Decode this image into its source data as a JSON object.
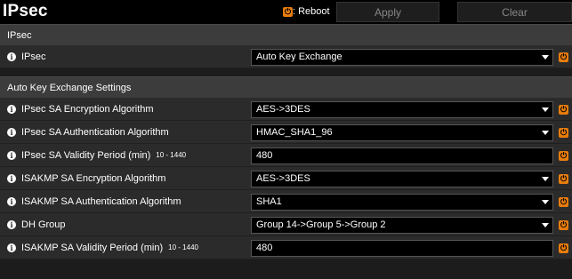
{
  "header": {
    "title": "IPsec",
    "reboot_label": ": Reboot",
    "apply_label": "Apply",
    "clear_label": "Clear"
  },
  "sections": [
    {
      "title": "IPsec"
    },
    {
      "title": "Auto Key Exchange Settings"
    }
  ],
  "ipsec_row": {
    "label": "IPsec",
    "value": "Auto Key Exchange"
  },
  "settings": [
    {
      "label": "IPsec SA Encryption Algorithm",
      "value": "AES->3DES",
      "type": "select"
    },
    {
      "label": "IPsec SA Authentication Algorithm",
      "value": "HMAC_SHA1_96",
      "type": "select"
    },
    {
      "label": "IPsec SA Validity Period (min)",
      "range": "10 - 1440",
      "value": "480",
      "type": "input"
    },
    {
      "label": "ISAKMP SA Encryption Algorithm",
      "value": "AES->3DES",
      "type": "select"
    },
    {
      "label": "ISAKMP SA Authentication Algorithm",
      "value": "SHA1",
      "type": "select"
    },
    {
      "label": "DH Group",
      "value": "Group 14->Group 5->Group 2",
      "type": "select"
    },
    {
      "label": "ISAKMP SA Validity Period (min)",
      "range": "10 - 1440",
      "value": "480",
      "type": "input"
    }
  ],
  "icons": {
    "info": "info-icon",
    "reboot": "reboot-icon",
    "dropdown": "chevron-down-icon"
  },
  "colors": {
    "accent": "#e87d0d",
    "section_bg": "#3c3c3c",
    "row_bg": "#2b2b2b"
  }
}
